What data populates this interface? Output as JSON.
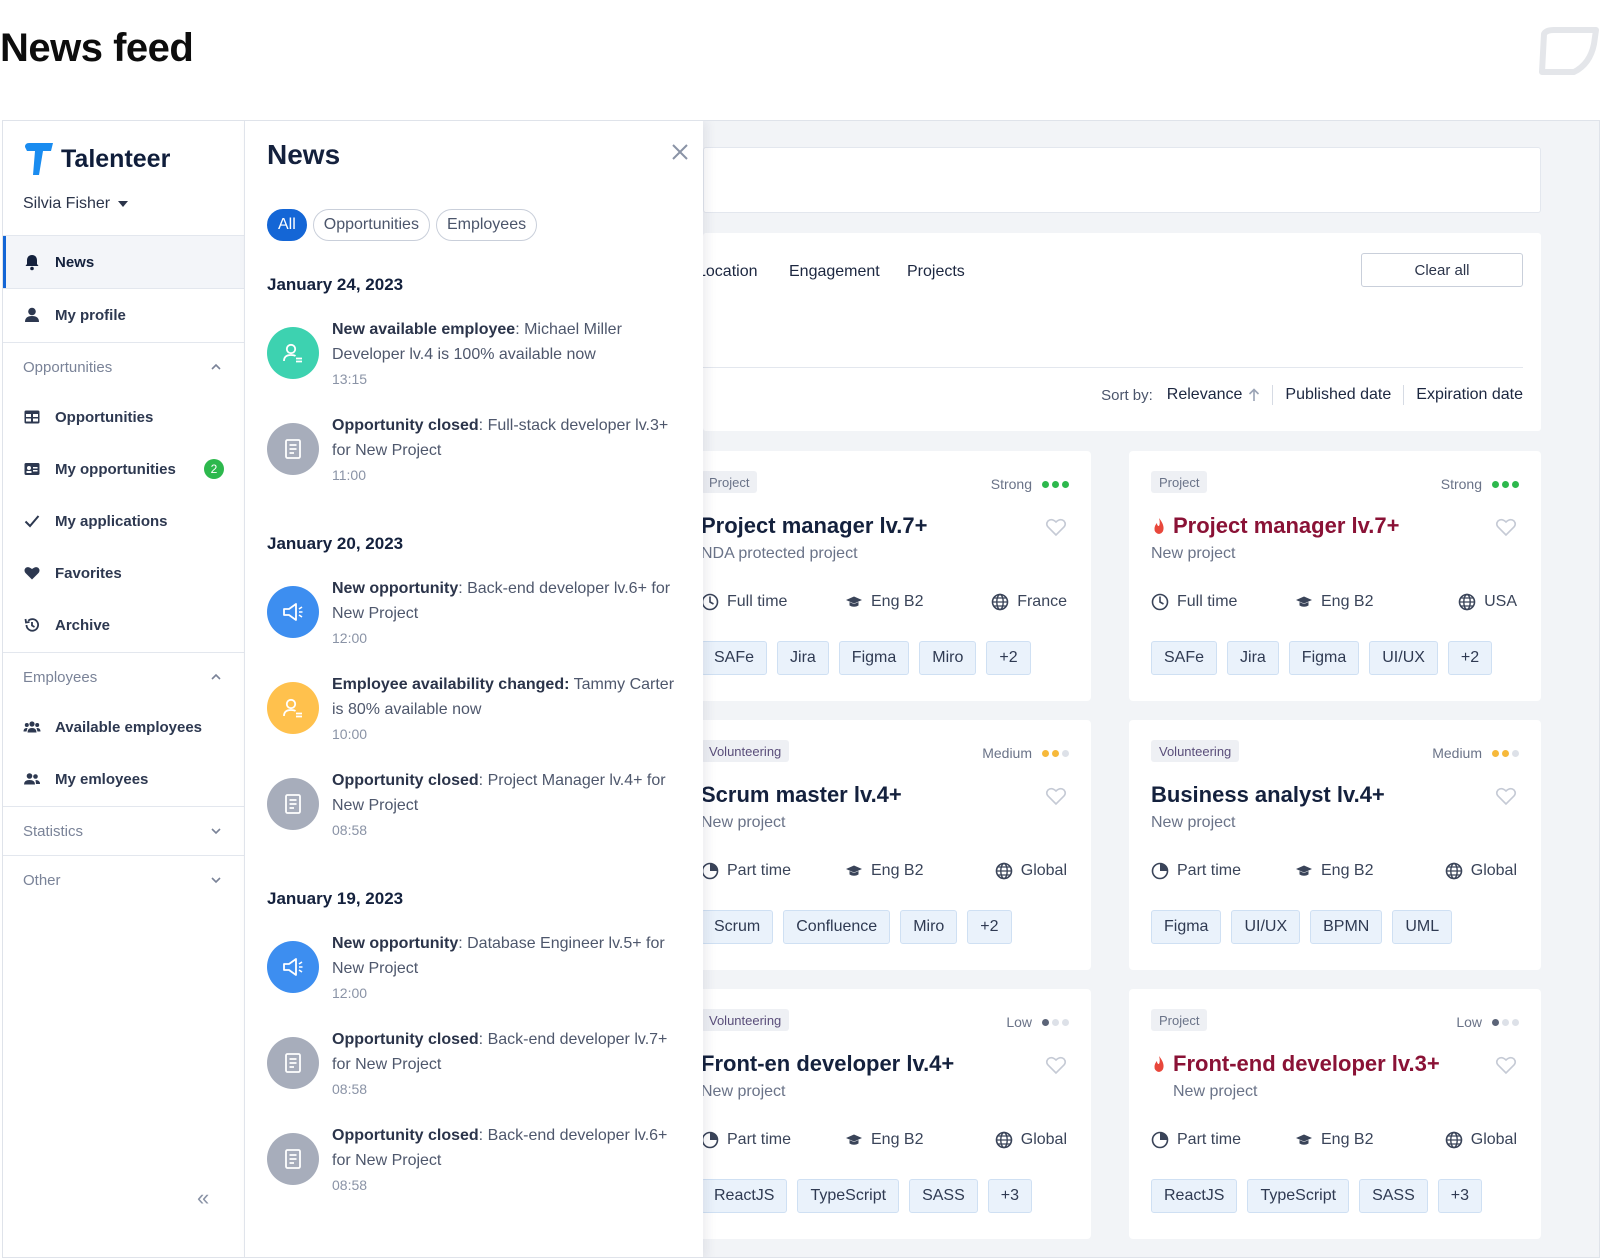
{
  "page": {
    "title": "News feed"
  },
  "sidebar": {
    "brand": "Talenteer",
    "user": "Silvia Fisher",
    "items": [
      {
        "label": "News"
      },
      {
        "label": "My profile"
      }
    ],
    "groups": {
      "opportunities": {
        "label": "Opportunities",
        "items": [
          "Opportunities",
          "My opportunities",
          "My applications",
          "Favorites",
          "Archive"
        ],
        "badge": "2"
      },
      "employees": {
        "label": "Employees",
        "items": [
          "Available employees",
          "My emloyees"
        ]
      },
      "statistics": {
        "label": "Statistics"
      },
      "other": {
        "label": "Other"
      }
    },
    "collapse": "«"
  },
  "news": {
    "title": "News",
    "filters": [
      "All",
      "Opportunities",
      "Employees"
    ],
    "groups": [
      {
        "date": "January 24, 2023",
        "items": [
          {
            "kind": "New available employee",
            "text": ": Michael Miller Developer lv.4 is 100% available now",
            "time": "13:15",
            "icon": "user-icon",
            "color": "#3dd2b0"
          },
          {
            "kind": "Opportunity closed",
            "text": ": Full-stack developer lv.3+ for New Project",
            "time": "11:00",
            "icon": "document-icon",
            "color": "#a7adbb"
          }
        ]
      },
      {
        "date": "January 20, 2023",
        "items": [
          {
            "kind": "New opportunity",
            "text": ": Back-end developer lv.6+ for New Project",
            "time": "12:00",
            "icon": "megaphone-icon",
            "color": "#3d8ef0"
          },
          {
            "kind": "Employee availability changed:",
            "text": " Tammy Carter is 80% available now",
            "time": "10:00",
            "icon": "user-icon",
            "color": "#ffc14d"
          },
          {
            "kind": "Opportunity closed",
            "text": ": Project Manager lv.4+ for New Project",
            "time": "08:58",
            "icon": "document-icon",
            "color": "#a7adbb"
          }
        ]
      },
      {
        "date": "January 19, 2023",
        "items": [
          {
            "kind": "New opportunity",
            "text": ": Database Engineer lv.5+ for New Project",
            "time": "12:00",
            "icon": "megaphone-icon",
            "color": "#3d8ef0"
          },
          {
            "kind": "Opportunity closed",
            "text": ": Back-end developer lv.7+ for New Project",
            "time": "08:58",
            "icon": "document-icon",
            "color": "#a7adbb"
          },
          {
            "kind": "Opportunity closed",
            "text": ": Back-end developer lv.6+ for New Project",
            "time": "08:58",
            "icon": "document-icon",
            "color": "#a7adbb"
          }
        ]
      }
    ]
  },
  "filters_panel": {
    "tabs": [
      "Location",
      "Engagement",
      "Projects"
    ],
    "clear_all": "Clear all",
    "sort_label": "Sort by:",
    "sort_options": [
      "Relevance",
      "Published date",
      "Expiration date"
    ]
  },
  "cards": [
    {
      "type": "Project",
      "strength": "Strong",
      "level": 3,
      "dot_color": "#2db84d",
      "title": "Project manager lv.7+",
      "hot": false,
      "sub": "NDA protected project",
      "time": "Full time",
      "lang": "Eng B2",
      "location": "France",
      "tags": [
        "SAFe",
        "Jira",
        "Figma",
        "Miro",
        "+2"
      ]
    },
    {
      "type": "Project",
      "strength": "Strong",
      "level": 3,
      "dot_color": "#2db84d",
      "title": "Project manager lv.7+",
      "hot": true,
      "sub": "New project",
      "time": "Full time",
      "lang": "Eng B2",
      "location": "USA",
      "tags": [
        "SAFe",
        "Jira",
        "Figma",
        "UI/UX",
        "+2"
      ]
    },
    {
      "type": "Volunteering",
      "strength": "Medium",
      "level": 2,
      "dot_color": "#f6b93b",
      "title": "Scrum master lv.4+",
      "hot": false,
      "sub": "New project",
      "time": "Part time",
      "lang": "Eng B2",
      "location": "Global",
      "tags": [
        "Scrum",
        "Confluence",
        "Miro",
        "+2"
      ]
    },
    {
      "type": "Volunteering",
      "strength": "Medium",
      "level": 2,
      "dot_color": "#f6b93b",
      "title": "Business analyst lv.4+",
      "hot": false,
      "sub": "New project",
      "time": "Part time",
      "lang": "Eng B2",
      "location": "Global",
      "tags": [
        "Figma",
        "UI/UX",
        "BPMN",
        "UML"
      ]
    },
    {
      "type": "Volunteering",
      "strength": "Low",
      "level": 1,
      "dot_color": "#5b6478",
      "title": "Front-en developer lv.4+",
      "hot": false,
      "sub": "New project",
      "time": "Part time",
      "lang": "Eng B2",
      "location": "Global",
      "tags": [
        "ReactJS",
        "TypeScript",
        "SASS",
        "+3"
      ]
    },
    {
      "type": "Project",
      "strength": "Low",
      "level": 1,
      "dot_color": "#5b6478",
      "title": "Front-end developer lv.3+",
      "hot": true,
      "sub": "New project",
      "time": "Part time",
      "lang": "Eng B2",
      "location": "Global",
      "tags": [
        "ReactJS",
        "TypeScript",
        "SASS",
        "+3"
      ]
    }
  ]
}
